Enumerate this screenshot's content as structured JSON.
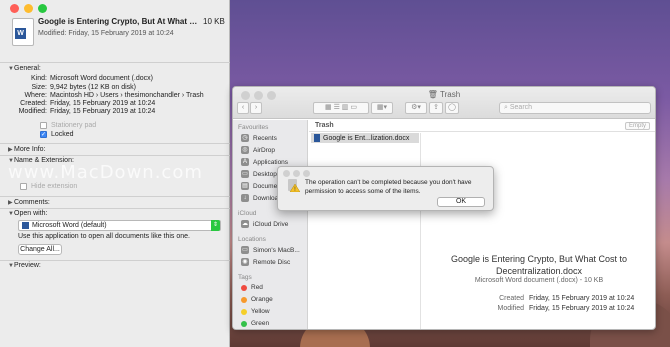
{
  "info_window": {
    "title": "Google is Entering Crypto, But At What Cost to Dec...",
    "size": "10 KB",
    "modified": "Modified: Friday, 15 February 2019 at 10:24",
    "general": {
      "header": "General:",
      "kind_label": "Kind:",
      "kind_value": "Microsoft Word document (.docx)",
      "size_label": "Size:",
      "size_value": "9,942 bytes (12 KB on disk)",
      "where_label": "Where:",
      "where_value": "Macintosh HD › Users › thesimonchandler › Trash",
      "created_label": "Created:",
      "created_value": "Friday, 15 February 2019 at 10:24",
      "modified_label": "Modified:",
      "modified_value": "Friday, 15 February 2019 at 10:24",
      "stationery_label": "Stationery pad",
      "locked_label": "Locked"
    },
    "more_info": "More Info:",
    "name_extension": "Name & Extension:",
    "hide_extension": "Hide extension",
    "comments": "Comments:",
    "open_with": {
      "header": "Open with:",
      "app": "Microsoft Word (default)",
      "note": "Use this application to open all documents like this one.",
      "change_all": "Change All..."
    },
    "preview": "Preview:"
  },
  "trash_window": {
    "title": "Trash",
    "search_placeholder": "Search",
    "path_label": "Trash",
    "empty_button": "Empty",
    "sidebar": {
      "favourites_header": "Favourites",
      "favourites": [
        "Recents",
        "AirDrop",
        "Applications",
        "Desktop",
        "Documents",
        "Downloads"
      ],
      "icloud_header": "iCloud",
      "icloud": [
        "iCloud Drive"
      ],
      "locations_header": "Locations",
      "locations": [
        "Simon's MacB...",
        "Remote Disc"
      ],
      "tags_header": "Tags",
      "tags": [
        {
          "name": "Red",
          "color": "#f04a3f"
        },
        {
          "name": "Orange",
          "color": "#f7992c"
        },
        {
          "name": "Yellow",
          "color": "#f5cf2a"
        },
        {
          "name": "Green",
          "color": "#34c14a"
        }
      ]
    },
    "file_row": "Google is Ent...lization.docx",
    "preview": {
      "name": "Google is Entering Crypto, But What Cost to Decentralization.docx",
      "kind": "Microsoft Word document (.docx) - 10 KB",
      "created_label": "Created",
      "created_value": "Friday, 15 February 2019 at 10:24",
      "modified_label": "Modified",
      "modified_value": "Friday, 15 February 2019 at 10:24"
    }
  },
  "alert": {
    "message": "The operation can't be completed because you don't have permission to access some of the items.",
    "ok": "OK"
  },
  "watermark": "www.MacDown.com"
}
